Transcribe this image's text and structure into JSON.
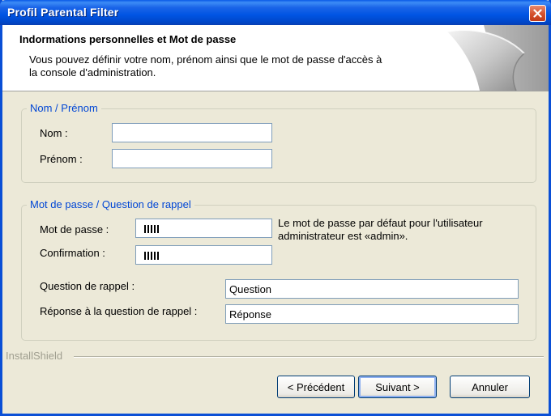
{
  "window": {
    "title": "Profil Parental Filter",
    "close_icon": "close-icon"
  },
  "header": {
    "title": "Indormations personnelles et Mot de passe",
    "description": "Vous pouvez définir votre nom, prénom ainsi que le mot de passe d'accès à la console d'administration."
  },
  "name_group": {
    "legend": "Nom / Prénom",
    "nom_label": "Nom :",
    "nom_value": "",
    "prenom_label": "Prénom :",
    "prenom_value": ""
  },
  "password_group": {
    "legend": "Mot de passe / Question de rappel",
    "password_label": "Mot de passe :",
    "confirmation_label": "Confirmation :",
    "password_mask": "IIIII",
    "note": "Le mot de passe par défaut pour l'utilisateur administrateur est «admin».",
    "question_label": "Question de rappel :",
    "question_value": "Question",
    "answer_label": "Réponse à la question de rappel :",
    "answer_value": "Réponse"
  },
  "footer": {
    "brand": "InstallShield",
    "back_label": "< Précédent",
    "next_label": "Suivant >",
    "cancel_label": "Annuler"
  },
  "colors": {
    "titlebar": "#0054e3",
    "dialog_bg": "#ece9d8",
    "group_legend": "#0046d5",
    "close_button": "#d4502c"
  }
}
